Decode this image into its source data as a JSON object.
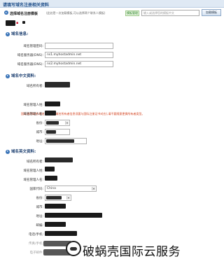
{
  "header": {
    "title": "请填写域名注册相关资料"
  },
  "template": {
    "label": "选择域名注册模板",
    "note": "(此处是一次加载模板,可以选择两个联系人模板)",
    "link": "模板管理",
    "select_placeholder": "输入或选择您的模板中文",
    "button": "加载模板"
  },
  "domain_info": {
    "heading": "域名信息:",
    "fields": [
      {
        "label": "域名管理密码:",
        "value": ""
      },
      {
        "label": "域名服务器(DNS):",
        "value": "ns1.myhostadmin.net"
      },
      {
        "label": "域名服务器(DNS):",
        "value": "ns2.myhostadmin.net"
      }
    ]
  },
  "cn_contact": {
    "heading": "域名中文资料:",
    "owner_label": "域名所有者:",
    "warning": "国际通用域名(域名注册国际域名所有者信息须要与国际注册证书对应),请不要随意更换所有者类型。",
    "fields": [
      {
        "label": "域名管理人姓:"
      },
      {
        "label": "域名管理人名:"
      },
      {
        "label": "省份:"
      },
      {
        "label": "城市:"
      },
      {
        "label": "地址:"
      }
    ]
  },
  "en_contact": {
    "heading": "域名英文资料:",
    "fields": [
      {
        "label": "域名所有者:"
      },
      {
        "label": "域名管理人姓:"
      },
      {
        "label": "域名管理人名:"
      },
      {
        "label": "国家代码:",
        "value": "China"
      },
      {
        "label": "省份:"
      },
      {
        "label": "城市:"
      },
      {
        "label": "地址:"
      },
      {
        "label": "邮编:"
      },
      {
        "label": "电话/手机:"
      },
      {
        "label": "传真/手机:"
      },
      {
        "label": "电子邮件:"
      }
    ]
  },
  "watermark": {
    "text": "破蜗壳国际云服务"
  }
}
